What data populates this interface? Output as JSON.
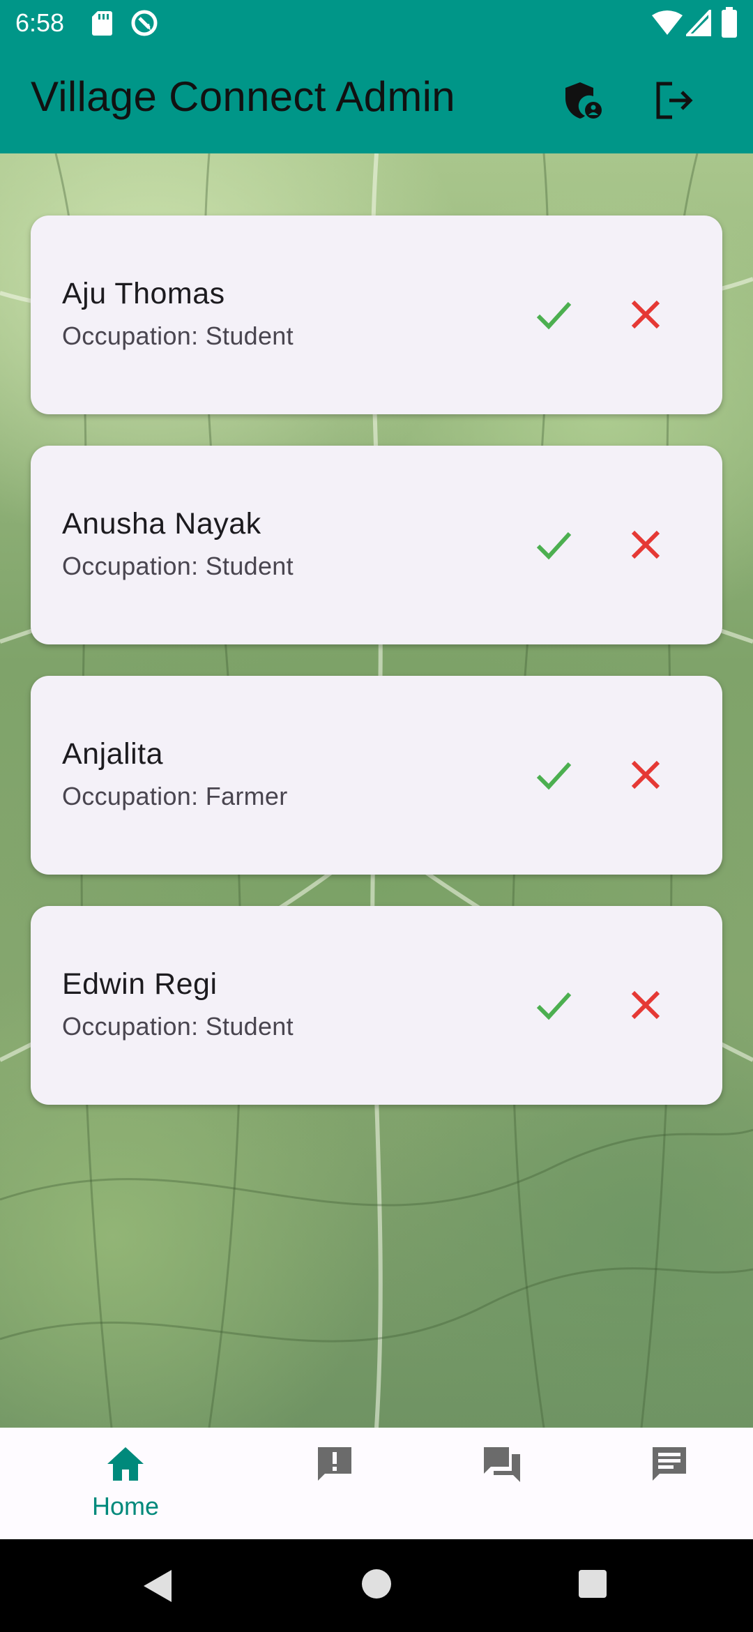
{
  "status_bar": {
    "time": "6:58"
  },
  "app_bar": {
    "title": "Village Connect Admin"
  },
  "requests": [
    {
      "name": "Aju Thomas",
      "occupation": "Occupation: Student"
    },
    {
      "name": "Anusha Nayak",
      "occupation": "Occupation: Student"
    },
    {
      "name": "Anjalita",
      "occupation": "Occupation: Farmer"
    },
    {
      "name": "Edwin Regi",
      "occupation": "Occupation: Student"
    }
  ],
  "bottom_nav": {
    "items": [
      {
        "icon": "home-icon",
        "label": "Home",
        "selected": true
      },
      {
        "icon": "report-icon",
        "label": "",
        "selected": false
      },
      {
        "icon": "forum-icon",
        "label": "",
        "selected": false
      },
      {
        "icon": "feed-icon",
        "label": "",
        "selected": false
      }
    ]
  },
  "colors": {
    "primary": "#009688",
    "approve": "#4caf50",
    "reject": "#e53935",
    "card": "#f4f1f8",
    "nav_selected": "#00897b",
    "nav_unselected": "#6b6b6b"
  }
}
